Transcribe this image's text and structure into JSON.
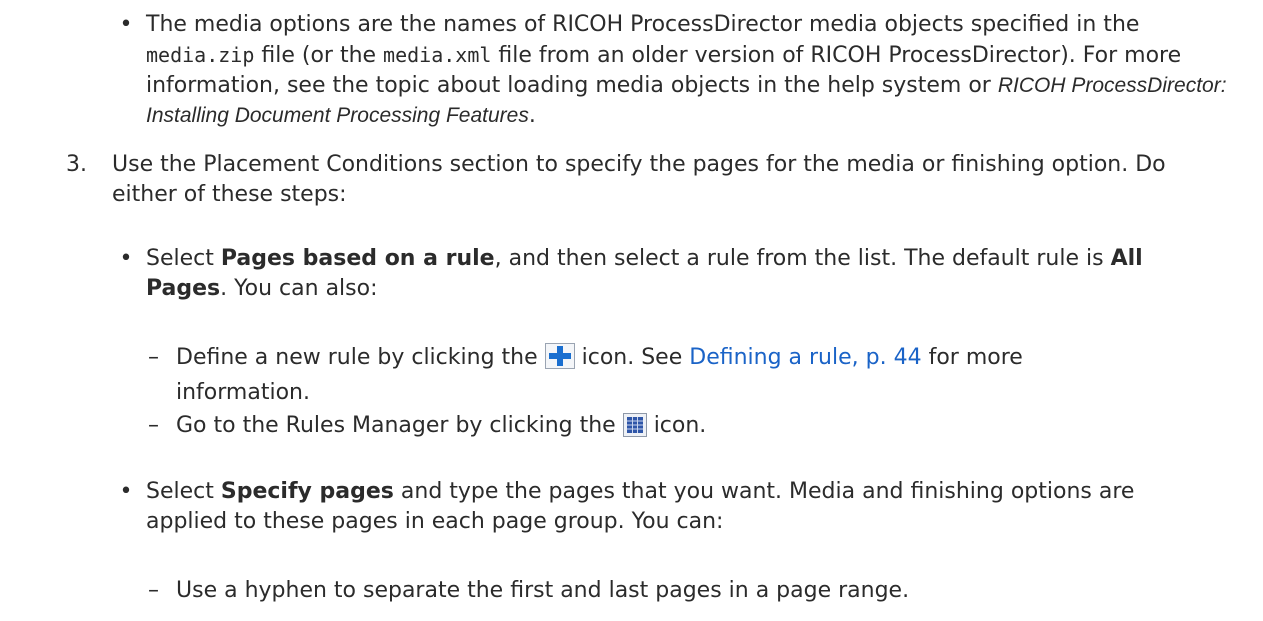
{
  "intro_bullet": {
    "p1": "The media options are the names of RICOH ProcessDirector media objects specified in the",
    "code1": "media.zip",
    "p2": " file (or the ",
    "code2": "media.xml",
    "p3": " file from an older version of RICOH ProcessDirector). For more information, see the topic about loading media objects in the help system or ",
    "ital": "RICOH ProcessDirector: Installing Document Processing Features",
    "p4": "."
  },
  "step3": {
    "number": "3.",
    "text_line1": "Use the Placement Conditions section to specify the pages for the media or finishing option. Do",
    "text_line2": "either of these steps:"
  },
  "bullet_rule": {
    "pre": "Select ",
    "bold1": "Pages based on a rule",
    "mid": ", and then select a rule from the list. The default rule is ",
    "bold2a": "All",
    "bold2b": "Pages",
    "post": ". You can also:"
  },
  "sub_define": {
    "pre": "Define a new rule by clicking the ",
    "post": " icon. See ",
    "link": "Defining a rule, p. 44",
    "post2": " for more",
    "line2": "information."
  },
  "sub_manager": {
    "pre": "Go to the Rules Manager by clicking the ",
    "post": " icon."
  },
  "bullet_specify": {
    "pre": "Select ",
    "bold": "Specify pages",
    "post": " and type the pages that you want. Media and finishing options are",
    "line2": "applied to these pages in each page group. You can:"
  },
  "sub_hyphen": {
    "text": "Use a hyphen to separate the first and last pages in a page range."
  },
  "markers": {
    "bullet": "•",
    "dash": "–"
  },
  "colors": {
    "text": "#2b2b2b",
    "link": "#1a63c7",
    "add_icon": "#1a6fd0",
    "grid_icon": "#2f56a8"
  },
  "icons": [
    "add-plus-icon",
    "rules-manager-grid-icon"
  ]
}
